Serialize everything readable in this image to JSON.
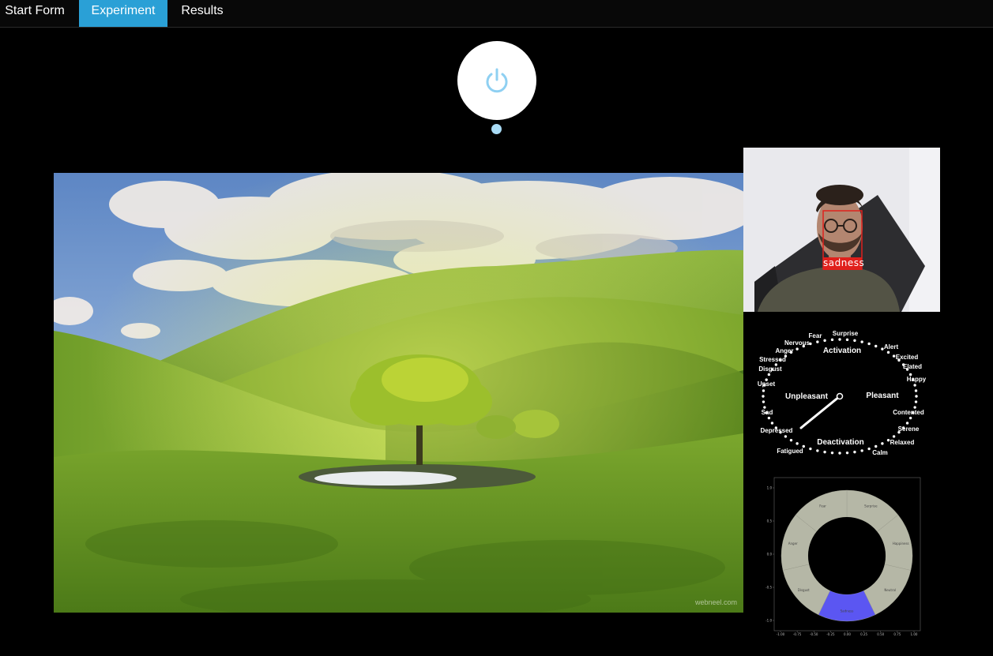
{
  "nav": {
    "tabs": [
      {
        "label": "Start Form",
        "active": false
      },
      {
        "label": "Experiment",
        "active": true
      },
      {
        "label": "Results",
        "active": false
      }
    ],
    "active_color": "#2aa0d6"
  },
  "controls": {
    "power_icon": "power-icon",
    "power_color": "#8fd0f2",
    "status_dot_color": "#a9dbf5"
  },
  "stimulus": {
    "watermark": "webneel.com"
  },
  "webcam": {
    "detected_emotion": "sadness",
    "box_color": "#e0201c"
  },
  "circumplex": {
    "axes": {
      "top": "Activation",
      "bottom": "Deactivation",
      "left": "Unpleasant",
      "right": "Pleasant"
    },
    "emotions": [
      "Surprise",
      "Fear",
      "Nervous",
      "Anger",
      "Stressed",
      "Disgust",
      "Upset",
      "Sad",
      "Depressed",
      "Fatigued",
      "Calm",
      "Relaxed",
      "Serene",
      "Contented",
      "Happy",
      "Elated",
      "Excited",
      "Alert"
    ]
  },
  "chart_data": {
    "type": "pie",
    "donut": true,
    "categories": [
      "Surprise",
      "Happiness",
      "Neutral",
      "Sadness",
      "Disgust",
      "Anger",
      "Fear"
    ],
    "values": [
      1,
      1,
      1,
      1,
      1,
      1,
      1
    ],
    "highlighted": "Sadness",
    "colors": {
      "default": "#b5b7a6",
      "highlight": "#5b56f2"
    },
    "xticks": [
      "-1.00",
      "-0.75",
      "-0.50",
      "-0.25",
      "0.00",
      "0.25",
      "0.50",
      "0.75",
      "1.00"
    ],
    "yticks": [
      "1.0",
      "0.5",
      "0.0",
      "-0.5",
      "-1.0"
    ],
    "xlim": [
      -1,
      1
    ],
    "ylim": [
      -1,
      1
    ]
  }
}
